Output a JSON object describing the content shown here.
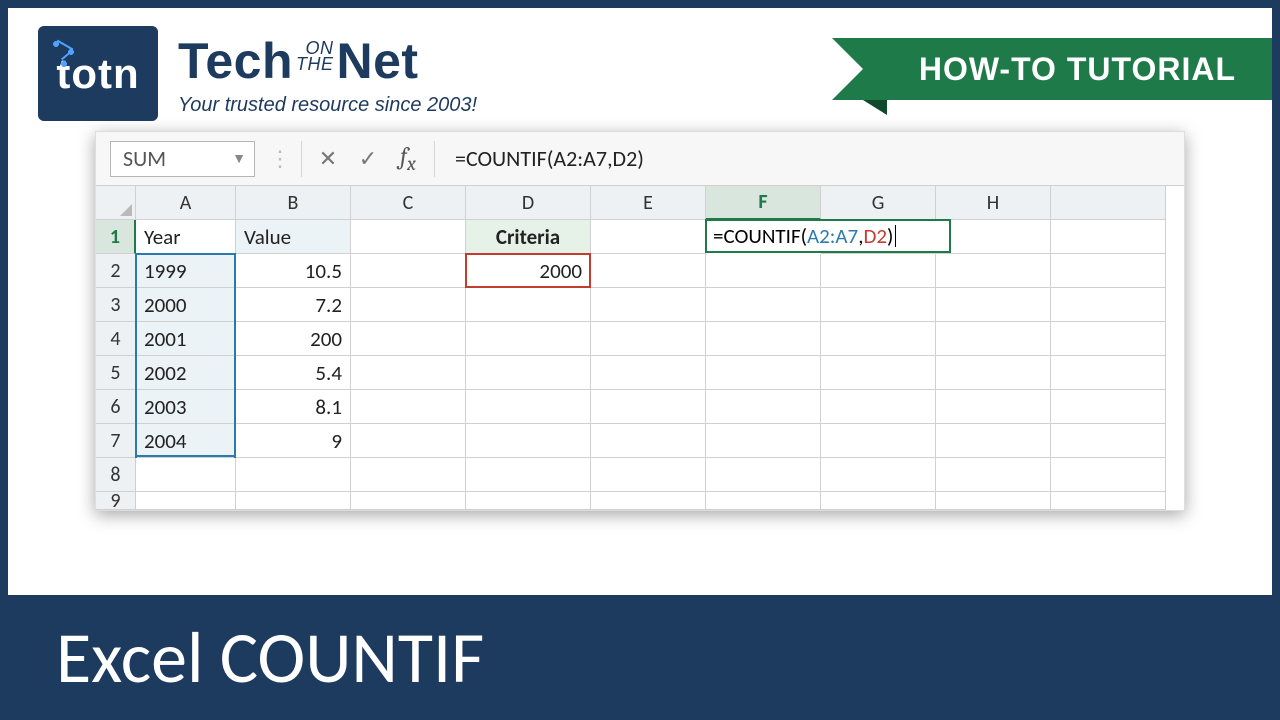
{
  "header": {
    "logo_text": "totn",
    "brand_prefix": "Tech",
    "brand_small1": "ON",
    "brand_small2": "THE",
    "brand_suffix": "Net",
    "tagline": "Your trusted resource since 2003!",
    "ribbon": "HOW-TO TUTORIAL"
  },
  "name_box": "SUM",
  "formula_bar": "=COUNTIF(A2:A7,D2)",
  "columns": [
    "A",
    "B",
    "C",
    "D",
    "E",
    "F",
    "G",
    "H"
  ],
  "rows": [
    "1",
    "2",
    "3",
    "4",
    "5",
    "6",
    "7",
    "8",
    "9"
  ],
  "cells": {
    "A1": "Year",
    "B1": "Value",
    "D1": "Criteria",
    "A2": "1999",
    "B2": "10.5",
    "A3": "2000",
    "B3": "7.2",
    "A4": "2001",
    "B4": "200",
    "A5": "2002",
    "B5": "5.4",
    "A6": "2003",
    "B6": "8.1",
    "A7": "2004",
    "B7": "9",
    "D2": "2000"
  },
  "active_formula": {
    "eq": "=",
    "fn": "COUNTIF(",
    "ref1": "A2:A7",
    "comma": ",",
    "ref2": "D2",
    "close": ")"
  },
  "footer": "Excel COUNTIF"
}
